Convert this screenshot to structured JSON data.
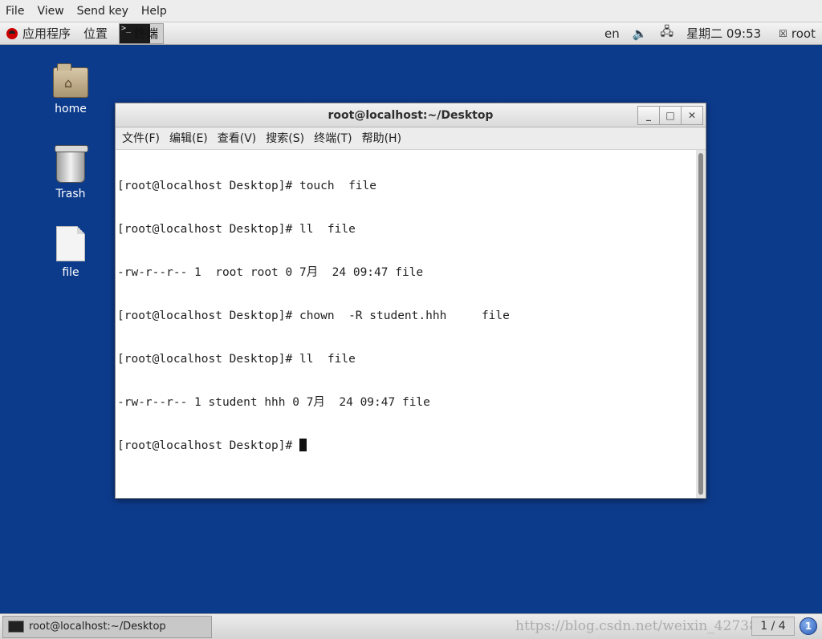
{
  "vm_menu": [
    "File",
    "View",
    "Send key",
    "Help"
  ],
  "panel": {
    "apps_label": "应用程序",
    "places_label": "位置",
    "terminal_label": "终端",
    "terminal_icon_glyph": ">_",
    "lang": "en",
    "clock": "星期二 09:53",
    "user": "root"
  },
  "desktop_icons": [
    {
      "name": "home-folder-icon",
      "label": "home"
    },
    {
      "name": "trash-icon",
      "label": "Trash"
    },
    {
      "name": "file-icon",
      "label": "file"
    }
  ],
  "terminal": {
    "title": "root@localhost:~/Desktop",
    "menus": [
      "文件(F)",
      "编辑(E)",
      "查看(V)",
      "搜索(S)",
      "终端(T)",
      "帮助(H)"
    ],
    "lines": [
      "[root@localhost Desktop]# touch  file",
      "[root@localhost Desktop]# ll  file",
      "-rw-r--r-- 1  root root 0 7月  24 09:47 file",
      "[root@localhost Desktop]# chown  -R student.hhh     file",
      "[root@localhost Desktop]# ll  file",
      "-rw-r--r-- 1 student hhh 0 7月  24 09:47 file",
      "[root@localhost Desktop]# "
    ],
    "win_buttons": {
      "minimize": "_",
      "maximize": "□",
      "close": "✕"
    }
  },
  "taskbar": {
    "task_label": "root@localhost:~/Desktop",
    "watermark": "https://blog.csdn.net/weixin_42738",
    "pager": "1 / 4",
    "workspace_badge": "1"
  },
  "colors": {
    "desktop_bg": "#0d3b8c",
    "panel_bg": "#e5e5e5"
  }
}
